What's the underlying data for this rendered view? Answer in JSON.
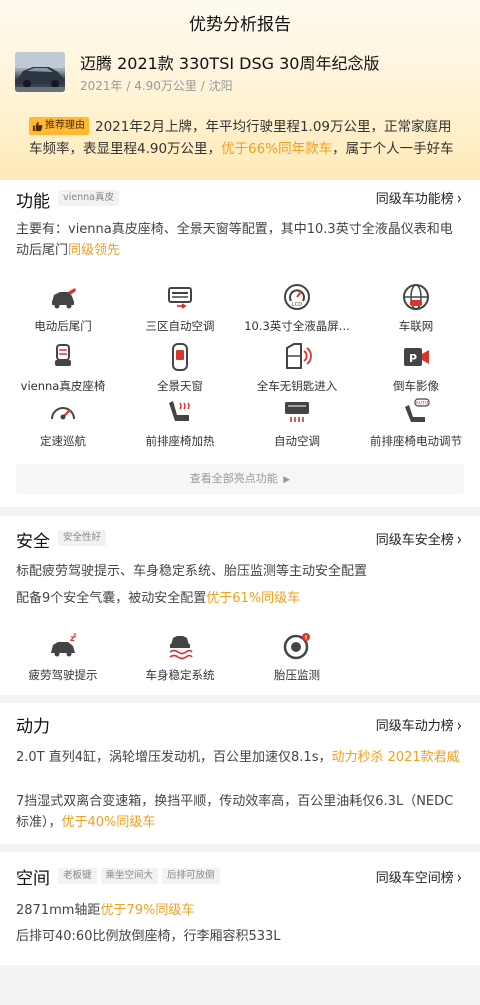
{
  "header": {
    "title": "优势分析报告"
  },
  "car": {
    "name": "迈腾 2021款 330TSI DSG 30周年纪念版",
    "meta": "2021年 / 4.90万公里 / 沈阳"
  },
  "reason": {
    "tag": "推荐理由",
    "line1": "2021年2月上牌，年平均行驶里程1.09万公里，正常家庭用",
    "line2_a": "车频率，表显里程4.90万公里，",
    "line2_hl": "优于66%同年款车",
    "line2_b": "，属于个人一手好车"
  },
  "function": {
    "title": "功能",
    "tags": [
      "vienna真皮"
    ],
    "rank_link": "同级车功能榜",
    "desc_a": "主要有：vienna真皮座椅、全景天窗等配置，其中10.3英寸全液晶仪表和电动后尾门",
    "desc_hl": "同级领先",
    "features": [
      {
        "label": "电动后尾门",
        "icon": "tailgate-icon"
      },
      {
        "label": "三区自动空调",
        "icon": "climate-icon"
      },
      {
        "label": "10.3英寸全液晶屏...",
        "icon": "lcd-gauge-icon"
      },
      {
        "label": "车联网",
        "icon": "connected-car-icon"
      },
      {
        "label": "vienna真皮座椅",
        "icon": "leather-seat-icon"
      },
      {
        "label": "全景天窗",
        "icon": "sunroof-icon"
      },
      {
        "label": "全车无钥匙进入",
        "icon": "keyless-entry-icon"
      },
      {
        "label": "倒车影像",
        "icon": "reverse-camera-icon"
      },
      {
        "label": "定速巡航",
        "icon": "cruise-control-icon"
      },
      {
        "label": "前排座椅加热",
        "icon": "seat-heating-icon"
      },
      {
        "label": "自动空调",
        "icon": "auto-ac-icon"
      },
      {
        "label": "前排座椅电动调节",
        "icon": "power-seat-icon"
      }
    ],
    "view_all": "查看全部亮点功能"
  },
  "safety": {
    "title": "安全",
    "tags": [
      "安全性好"
    ],
    "rank_link": "同级车安全榜",
    "line1": "标配疲劳驾驶提示、车身稳定系统、胎压监测等主动安全配置",
    "line2_a": "配备9个安全气囊，被动安全配置",
    "line2_hl": "优于61%同级车",
    "features": [
      {
        "label": "疲劳驾驶提示",
        "icon": "fatigue-alert-icon"
      },
      {
        "label": "车身稳定系统",
        "icon": "stability-control-icon"
      },
      {
        "label": "胎压监测",
        "icon": "tire-pressure-icon"
      }
    ]
  },
  "power": {
    "title": "动力",
    "rank_link": "同级车动力榜",
    "line1_a": "2.0T 直列4缸，涡轮增压发动机，百公里加速仅8.1s，",
    "line1_hl": "动力秒杀 2021款君威",
    "line2_a": "7挡湿式双离合变速箱，换挡平顺，传动效率高，百公里油耗仅6.3L（NEDC标准），",
    "line2_hl": "优于40%同级车"
  },
  "space": {
    "title": "空间",
    "tags": [
      "老板键",
      "乘坐空间大",
      "后排可放倒"
    ],
    "rank_link": "同级车空间榜",
    "line1_a": "2871mm轴距",
    "line1_hl": "优于79%同级车",
    "line2": "后排可40:60比例放倒座椅，行李厢容积533L"
  },
  "colors": {
    "accent": "#f0a020",
    "tag_bg": "#ffb935",
    "hero_bg": "#fff3d6"
  }
}
